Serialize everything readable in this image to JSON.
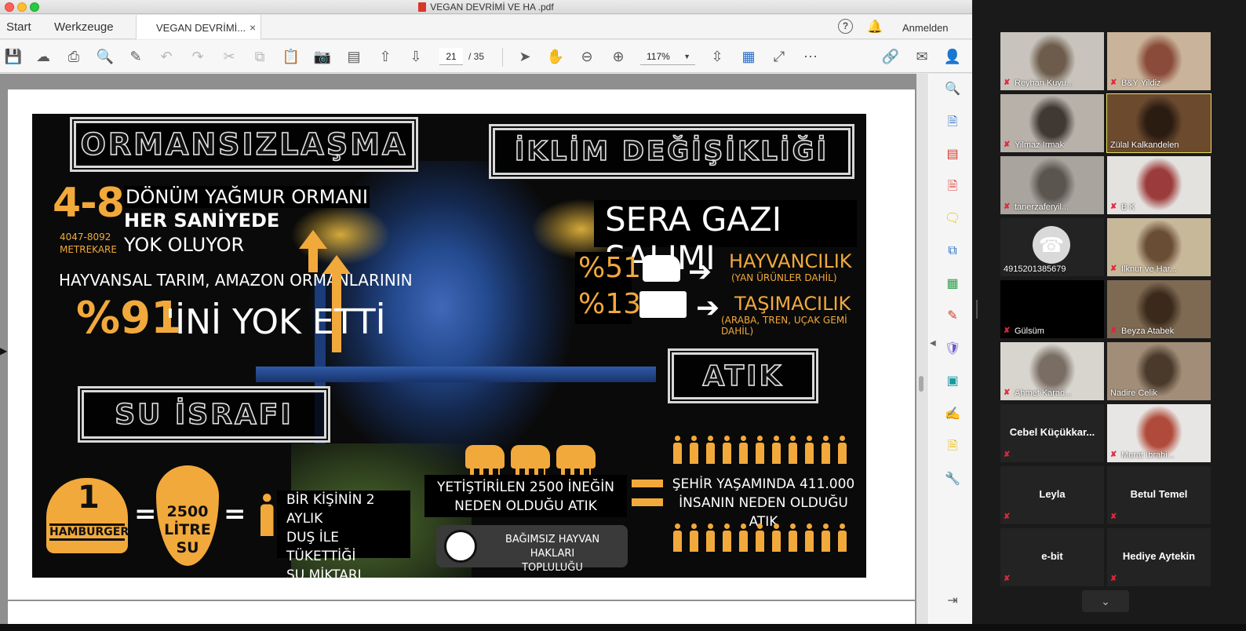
{
  "window": {
    "title": "VEGAN DEVRİMİ VE HA .pdf"
  },
  "menu": {
    "start": "Start",
    "tools": "Werkzeuge",
    "tab_label": "VEGAN DEVRİMİ...",
    "tab_close": "×",
    "signin": "Anmelden",
    "help": "?"
  },
  "toolbar": {
    "page_current": "21",
    "page_total": "/ 35",
    "zoom": "117%"
  },
  "infographic": {
    "deforestation": {
      "title": "ORMANSIZLAŞMA",
      "range": "4-8",
      "range_sub1": "4047-8092",
      "range_sub2": "METREKARE",
      "line1": "DÖNÜM YAĞMUR ORMANI",
      "line2": "HER SANİYEDE",
      "line3": "YOK OLUYOR",
      "statement": "HAYVANSAL TARIM, AMAZON ORMANLARININ",
      "percent": "%91",
      "percent_tail": "'İNİ YOK ETTİ"
    },
    "climate": {
      "title": "İKLİM DEĞİŞİKLİĞİ",
      "subtitle": "SERA GAZI SALIMI",
      "row1_percent": "%51",
      "row1_label": "HAYVANCILIK",
      "row1_sub": "(YAN ÜRÜNLER DAHİL)",
      "row2_percent": "%13",
      "row2_label": "TAŞIMACILIK",
      "row2_sub": "(ARABA, TREN, UÇAK GEMİ DAHİL)"
    },
    "water": {
      "title": "SU İSRAFI",
      "burger_number": "1",
      "burger_label": "HAMBURGER",
      "equals": "=",
      "drop_value": "2500",
      "drop_unit": "LİTRE",
      "drop_unit2": "SU",
      "shower_line1": "BİR KİŞİNİN 2 AYLIK",
      "shower_line2": "DUŞ İLE TÜKETTİĞİ",
      "shower_line3": "SU MİKTARI"
    },
    "waste": {
      "title": "ATIK",
      "cows_line1": "YETİŞTİRİLEN 2500 İNEĞİN",
      "cows_line2": "NEDEN OLDUĞU ATIK",
      "city_line1": "ŞEHİR YAŞAMINDA 411.000",
      "city_line2": "İNSANIN NEDEN OLDUĞU ATIK"
    },
    "org": {
      "line1": "BAĞIMSIZ HAYVAN HAKLARI",
      "line2": "TOPLULUĞU"
    }
  },
  "participants": [
    {
      "name": "Reyhan Kuyu...",
      "video": true,
      "muted": true
    },
    {
      "name": "B&Y Yildiz",
      "video": true,
      "muted": true
    },
    {
      "name": "Yilmaz Irmak",
      "video": true,
      "muted": true
    },
    {
      "name": "Zülal Kalkandelen",
      "video": true,
      "muted": false,
      "active": true
    },
    {
      "name": "tanerzaferyil...",
      "video": true,
      "muted": true
    },
    {
      "name": "B K",
      "video": true,
      "muted": true
    },
    {
      "name": "4915201385679",
      "video": false,
      "muted": false,
      "phone": true
    },
    {
      "name": "Ilknur ve Har...",
      "video": true,
      "muted": true
    },
    {
      "name": "Gülsüm",
      "video": false,
      "muted": true
    },
    {
      "name": "Beyza Atabek",
      "video": true,
      "muted": true
    },
    {
      "name": "Ahmet Karad...",
      "video": true,
      "muted": true
    },
    {
      "name": "Nadire Celik",
      "video": true,
      "muted": false
    },
    {
      "name": "Cebel  Küçükkar...",
      "video": false,
      "muted": true
    },
    {
      "name": "Murat Ibrahi...",
      "video": true,
      "muted": true
    },
    {
      "name": "Leyla",
      "video": false,
      "muted": true
    },
    {
      "name": "Betul Temel",
      "video": false,
      "muted": true
    },
    {
      "name": "e-bit",
      "video": false,
      "muted": true
    },
    {
      "name": "Hediye Aytekin",
      "video": false,
      "muted": true
    }
  ],
  "colors": {
    "accent_orange": "#f2a93b",
    "acrobat_blue": "#2b6fc7",
    "mute_red": "#e0263c",
    "active_border": "#e6e25f"
  }
}
